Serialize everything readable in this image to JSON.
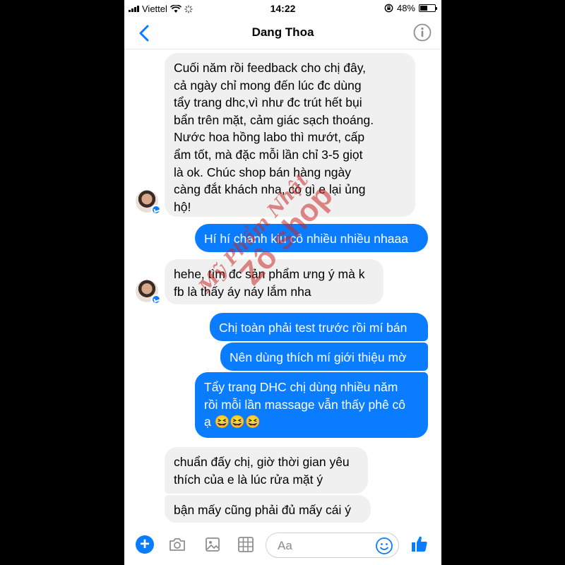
{
  "status": {
    "carrier": "Viettel",
    "time": "14:22",
    "battery": "48%"
  },
  "header": {
    "title": "Dang Thoa"
  },
  "messages": [
    {
      "lines": [
        "Cuối năm rồi feedback cho chị đây,",
        "cả ngày chỉ mong đến lúc đc dùng",
        "tẩy trang dhc,vì như đc trút hết bụi",
        "bẩn trên mặt, cảm giác sạch thoáng.",
        "Nước hoa hồng labo thì mướt, cấp",
        "ẩm tốt, mà đặc mỗi lần chỉ 3-5 giọt",
        "là ok. Chúc shop bán hàng ngày",
        "càng đắt khách nha, có gì e lại ủng",
        "hộ!"
      ]
    },
    {
      "lines": [
        "Hí hí chanh kiu cô nhiều nhiều nhaaa"
      ]
    },
    {
      "lines": [
        "hehe, tìm đc sản phẩm ưng ý mà k",
        "fb là thấy áy náy lắm nha"
      ]
    },
    {
      "lines": [
        "Chị toàn phải test trước rồi mí bán"
      ]
    },
    {
      "lines": [
        "Nên dùng thích mí giới thiệu mờ"
      ]
    },
    {
      "lines": [
        "Tẩy trang DHC chị dùng nhiều năm",
        "rồi mỗi lần massage vẫn thấy phê cô",
        "ạ 😆😆😆"
      ]
    },
    {
      "lines": [
        "chuẩn đấy chị, giờ thời gian yêu",
        "thích của e là lúc rửa mặt ý"
      ]
    },
    {
      "lines": [
        "bận mấy cũng phải đủ mấy cái ý"
      ]
    }
  ],
  "watermark": {
    "line1": "Mỹ Phẩm Nhật",
    "line2": "Zô shop"
  },
  "composer": {
    "placeholder": "Aa"
  },
  "colors": {
    "accent": "#0a7cff",
    "incoming": "#f1f0f0"
  }
}
